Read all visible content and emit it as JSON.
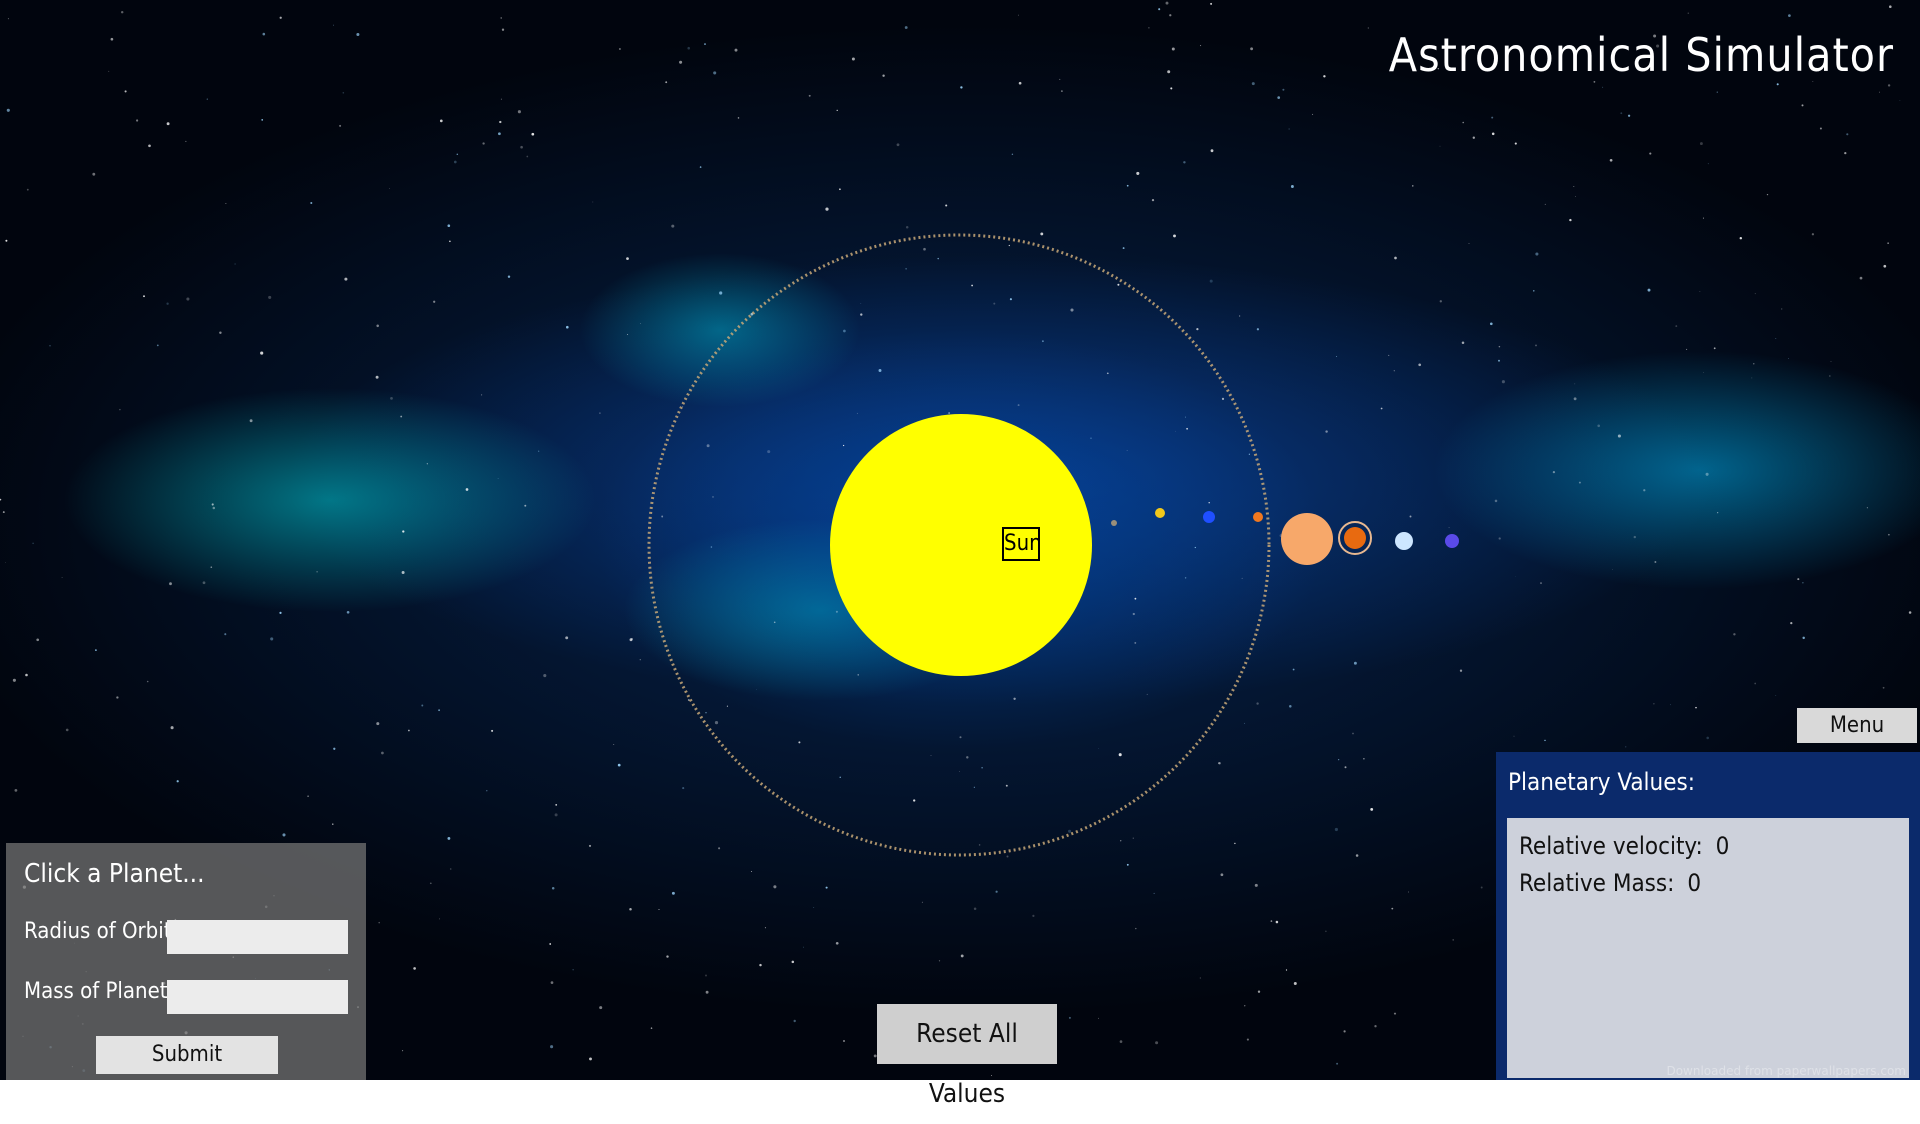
{
  "app": {
    "title": "Astronomical Simulator"
  },
  "scene": {
    "sun": {
      "label": "Sun",
      "color": "#ffff00"
    },
    "orbit_color": "#c8a878",
    "planets": [
      {
        "color": "#9a8f7a"
      },
      {
        "color": "#f2c81a"
      },
      {
        "color": "#1f4fff"
      },
      {
        "color": "#f07820"
      },
      {
        "color": "#f7a86a"
      },
      {
        "color": "#e86a10"
      },
      {
        "color": "#cde6ff"
      },
      {
        "color": "#5a4ae8"
      }
    ]
  },
  "left_panel": {
    "heading": "Click a Planet...",
    "radius_label": "Radius of Orbit:",
    "radius_value": "",
    "mass_label": "Mass of Planet:",
    "mass_value": "",
    "submit_label": "Submit"
  },
  "reset_button": {
    "label": "Reset All Values"
  },
  "menu_button": {
    "label": "Menu"
  },
  "right_panel": {
    "heading": "Planetary Values:",
    "velocity_label": "Relative velocity:",
    "velocity_value": "0",
    "mass_label": "Relative Mass:",
    "mass_value": "0"
  },
  "watermark": "Downloaded from paperwallpapers.com"
}
